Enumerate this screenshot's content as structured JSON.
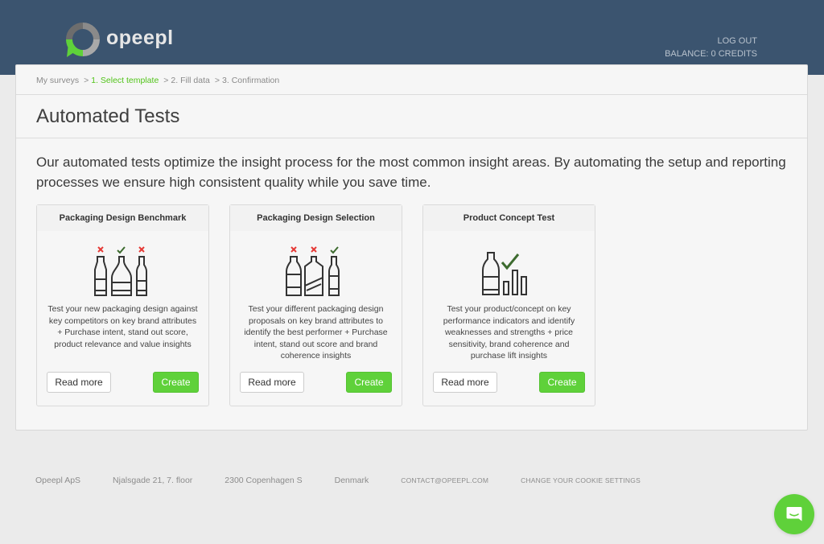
{
  "header": {
    "brand": "opeepl",
    "logout": "LOG OUT",
    "balance": "BALANCE: 0 CREDITS"
  },
  "breadcrumb": {
    "items": [
      "My surveys",
      "1. Select template",
      "2. Fill data",
      "3. Confirmation"
    ],
    "separator": ">",
    "active_index": 1
  },
  "page": {
    "title": "Automated Tests",
    "intro": "Our automated tests optimize the insight process for the most common insight areas. By automating the setup and reporting processes we ensure high consistent quality while you save time."
  },
  "cards": [
    {
      "title": "Packaging Design Benchmark",
      "icon": "three-bottles-middle-selected-icon",
      "description": "Test your new packaging design against key competitors on key brand attributes + Purchase intent, stand out score, product relevance and value insights",
      "read_more": "Read more",
      "create": "Create"
    },
    {
      "title": "Packaging Design Selection",
      "icon": "three-bottles-right-selected-icon",
      "description": "Test your different packaging design proposals on key brand attributes to identify the best performer + Purchase intent, stand out score and brand coherence insights",
      "read_more": "Read more",
      "create": "Create"
    },
    {
      "title": "Product Concept Test",
      "icon": "bottle-bar-chart-check-icon",
      "description": "Test your product/concept on key performance indicators and identify weaknesses and strengths + price sensitivity, brand coherence and purchase lift insights",
      "read_more": "Read more",
      "create": "Create"
    }
  ],
  "footer": {
    "company": "Opeepl ApS",
    "street": "Njalsgade 21, 7. floor",
    "city": "2300 Copenhagen S",
    "country": "Denmark",
    "email": "CONTACT@OPEEPL.COM",
    "cookies": "CHANGE YOUR COOKIE SETTINGS"
  },
  "colors": {
    "header_bg": "#3b546f",
    "accent_green": "#5fd13a",
    "breadcrumb_active": "#52c41a",
    "mark_red": "#e53935",
    "mark_check": "#3d6b2f"
  }
}
